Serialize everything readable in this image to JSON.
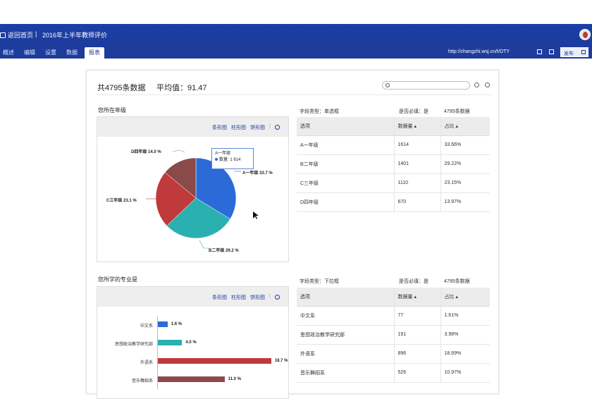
{
  "header": {
    "home_label": "返回首页",
    "separator": "|",
    "survey_title": "2016年上半年教师评价"
  },
  "nav": {
    "tabs": [
      {
        "label": "概述"
      },
      {
        "label": "编辑"
      },
      {
        "label": "设置"
      },
      {
        "label": "数据"
      },
      {
        "label": "报表"
      }
    ],
    "active_tab": "报表",
    "url": "http://changzhi.wsj.cn/t/OTY",
    "publish_label": "发布"
  },
  "summary": {
    "total": "共4795条数据",
    "average": "平均值：91.47"
  },
  "colors": {
    "brand": "#1d3c9c",
    "blue": "#2b6bd8",
    "teal": "#2ab0b0",
    "red": "#c0393b",
    "darkred": "#8b4a4a"
  },
  "q1": {
    "title": "您所在年级",
    "chart_types": [
      "条形图",
      "柱形图",
      "饼形图"
    ],
    "field_type": "字段类型：单选框",
    "required": "是否必填：是",
    "count": "4795条数据",
    "columns": [
      "选项",
      "数据量 ▴",
      "占比 ▴"
    ],
    "rows": [
      {
        "option": "A一年级",
        "count": "1614",
        "pct": "33.66%"
      },
      {
        "option": "B二年级",
        "count": "1401",
        "pct": "29.22%"
      },
      {
        "option": "C三年级",
        "count": "1110",
        "pct": "23.15%"
      },
      {
        "option": "D四年级",
        "count": "670",
        "pct": "13.97%"
      }
    ],
    "tooltip": {
      "title": "A一年级",
      "text": "数量: 1 614"
    },
    "pie_labels": {
      "a": "A一年级 33.7 %",
      "b": "B二年级 29.2 %",
      "c": "C三年级 23.1 %",
      "d": "D四年级 14.0 %"
    }
  },
  "q2": {
    "title": "您所学的专业是",
    "chart_types": [
      "条形图",
      "柱形图",
      "饼形图"
    ],
    "field_type": "字段类型：下拉框",
    "required": "是否必填：是",
    "count": "4795条数据",
    "columns": [
      "选项",
      "数据量 ▴",
      "占比 ▴"
    ],
    "rows": [
      {
        "option": "中文系",
        "count": "77",
        "pct": "1.61%"
      },
      {
        "option": "思想政治教学研究部",
        "count": "191",
        "pct": "3.98%"
      },
      {
        "option": "外语系",
        "count": "896",
        "pct": "18.69%"
      },
      {
        "option": "音乐舞蹈系",
        "count": "526",
        "pct": "10.97%"
      }
    ],
    "bar_labels": [
      "中文系",
      "思想政治教学研究部",
      "外语系",
      "音乐舞蹈系"
    ],
    "bar_values": [
      "1.6 %",
      "4.0 %",
      "18.7 %",
      "11.0 %"
    ]
  },
  "chart_data": [
    {
      "type": "pie",
      "categories": [
        "A一年级",
        "B二年级",
        "C三年级",
        "D四年级"
      ],
      "values": [
        33.7,
        29.2,
        23.1,
        14.0
      ],
      "colors": [
        "#2b6bd8",
        "#2ab0b0",
        "#c0393b",
        "#8b4a4a"
      ]
    },
    {
      "type": "bar",
      "categories": [
        "中文系",
        "思想政治教学研究部",
        "外语系",
        "音乐舞蹈系"
      ],
      "values": [
        1.6,
        4.0,
        18.7,
        11.0
      ],
      "colors": [
        "#2b6bd8",
        "#2ab0b0",
        "#c0393b",
        "#8b4a4a"
      ]
    }
  ]
}
